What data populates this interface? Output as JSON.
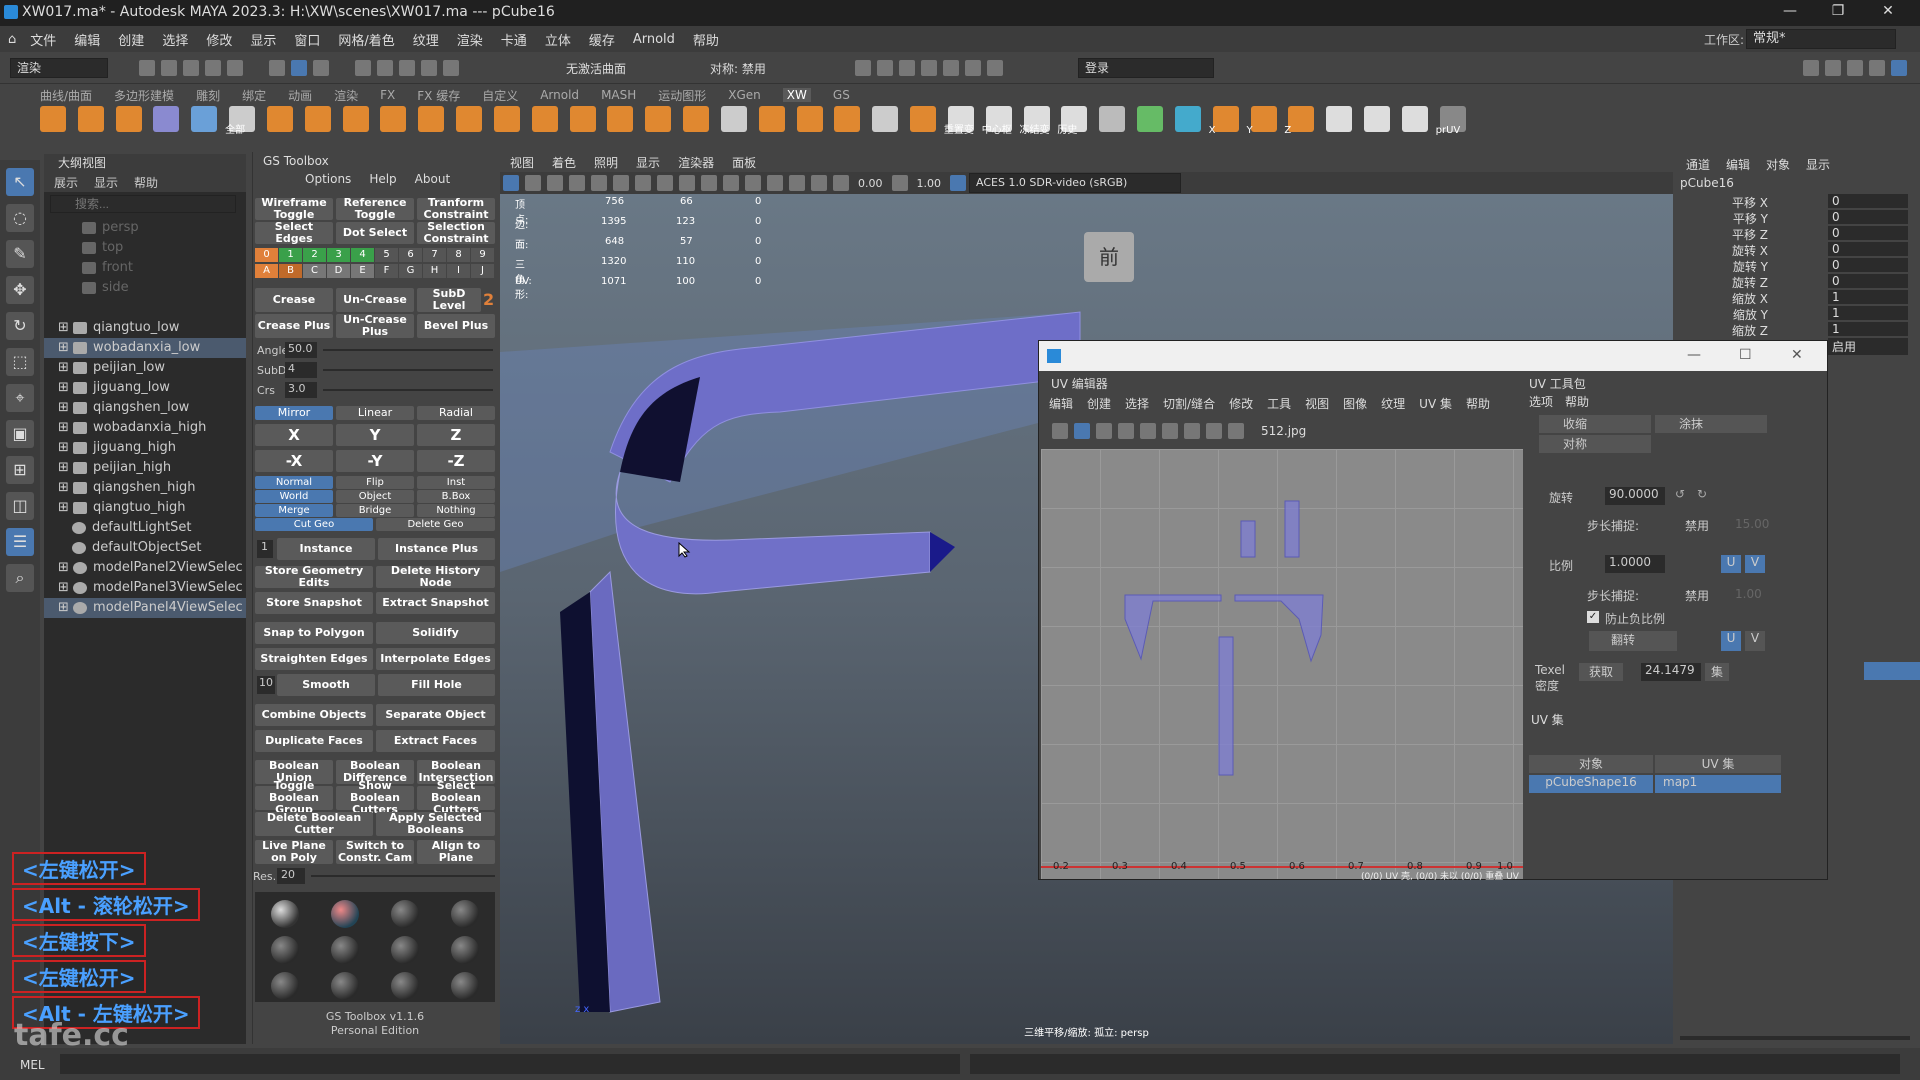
{
  "titlebar": {
    "title": "XW017.ma* - Autodesk MAYA 2023.3: H:\\XW\\scenes\\XW017.ma  ---  pCube16",
    "workspace_label": "工作区:",
    "workspace_value": "常规*"
  },
  "menubar": {
    "items": [
      "文件",
      "编辑",
      "创建",
      "选择",
      "修改",
      "显示",
      "窗口",
      "网格/着色",
      "纹理",
      "渲染",
      "卡通",
      "立体",
      "缓存",
      "Arnold",
      "帮助"
    ]
  },
  "status": {
    "mode": "渲染",
    "live_surface": "无激活曲面",
    "symmetry": "对称: 禁用",
    "login": "登录"
  },
  "shelf": {
    "tabs": [
      "曲线/曲面",
      "多边形建模",
      "雕刻",
      "绑定",
      "动画",
      "渲染",
      "FX",
      "FX 缓存",
      "自定义",
      "Arnold",
      "MASH",
      "运动图形",
      "XGen",
      "XW",
      "GS"
    ],
    "active_tab": "XW",
    "labels": {
      "all": "全部",
      "reset": "重置变",
      "center": "中心枢",
      "freeze": "冻结变",
      "history": "历史",
      "x": "X",
      "y": "Y",
      "z": "Z",
      "pruv": "prUV"
    }
  },
  "outliner": {
    "title": "大纲视图",
    "menu": [
      "展示",
      "显示",
      "帮助"
    ],
    "search_placeholder": "搜索...",
    "items": [
      {
        "label": "persp",
        "dim": true
      },
      {
        "label": "top",
        "dim": true
      },
      {
        "label": "front",
        "dim": true
      },
      {
        "label": "side",
        "dim": true
      },
      {
        "label": "qiangtuo_low"
      },
      {
        "label": "wobadanxia_low",
        "selected": true
      },
      {
        "label": "peijian_low"
      },
      {
        "label": "jiguang_low"
      },
      {
        "label": "qiangshen_low"
      },
      {
        "label": "wobadanxia_high"
      },
      {
        "label": "jiguang_high"
      },
      {
        "label": "peijian_high"
      },
      {
        "label": "qiangshen_high"
      },
      {
        "label": "qiangtuo_high"
      },
      {
        "label": "defaultLightSet"
      },
      {
        "label": "defaultObjectSet"
      },
      {
        "label": "modelPanel2ViewSelec"
      },
      {
        "label": "modelPanel3ViewSelec"
      },
      {
        "label": "modelPanel4ViewSelec",
        "selected": true
      }
    ]
  },
  "gs": {
    "title": "GS Toolbox",
    "menu": [
      "Options",
      "Help",
      "About"
    ],
    "wireframe": "Wireframe Toggle",
    "reference": "Reference Toggle",
    "transform": "Tranform Constraint",
    "select_edges": "Select Edges",
    "dot_select": "Dot Select",
    "selection_constraint": "Selection Constraint",
    "nums": [
      "0",
      "1",
      "2",
      "3",
      "4",
      "5",
      "6",
      "7",
      "8",
      "9"
    ],
    "letters": [
      "A",
      "B",
      "C",
      "D",
      "E",
      "F",
      "G",
      "H",
      "I",
      "J"
    ],
    "crease": "Crease",
    "uncrease": "Un-Crease",
    "subd_level": "SubD Level",
    "subd_value": "2",
    "crease_plus": "Crease Plus",
    "uncrease_plus": "Un-Crease Plus",
    "bevel_plus": "Bevel Plus",
    "angle_label": "Angle",
    "angle": "50.0",
    "subd_label": "SubD",
    "subd": "4",
    "crs_label": "Crs",
    "crs": "3.0",
    "mirror": "Mirror",
    "linear": "Linear",
    "radial": "Radial",
    "x": "X",
    "y": "Y",
    "z": "Z",
    "nx": "-X",
    "ny": "-Y",
    "nz": "-Z",
    "normal": "Normal",
    "flip": "Flip",
    "inst": "Inst",
    "world": "World",
    "object": "Object",
    "bbox": "B.Box",
    "merge": "Merge",
    "bridge": "Bridge",
    "nothing": "Nothing",
    "cutgeo": "Cut Geo",
    "deletegeo": "Delete Geo",
    "inst_count": "1",
    "instance": "Instance",
    "instance_plus": "Instance Plus",
    "store_geo": "Store Geometry Edits",
    "delete_history": "Delete History Node",
    "store_snap": "Store Snapshot",
    "extract_snap": "Extract Snapshot",
    "snap_poly": "Snap to Polygon",
    "solidify": "Solidify",
    "straighten": "Straighten Edges",
    "interpolate": "Interpolate Edges",
    "smooth_count": "10",
    "smooth": "Smooth",
    "fillhole": "Fill Hole",
    "combine": "Combine Objects",
    "separate": "Separate Object",
    "duplicate": "Duplicate Faces",
    "extract": "Extract Faces",
    "bool_union": "Boolean Union",
    "bool_diff": "Boolean Difference",
    "bool_inter": "Boolean Intersection",
    "toggle_bool": "Toggle Boolean Group",
    "show_cutters": "Show Boolean Cutters",
    "select_cutters": "Select Boolean Cutters",
    "delete_cutter": "Delete Boolean Cutter",
    "apply_bool": "Apply Selected Booleans",
    "live_plane": "Live Plane on Poly",
    "switch_cam": "Switch to Constr. Cam",
    "align_plane": "Align to Plane",
    "res_label": "Res.",
    "res": "20",
    "version": "GS Toolbox v1.1.6",
    "edition": "Personal Edition"
  },
  "viewport": {
    "menu": [
      "视图",
      "着色",
      "照明",
      "显示",
      "渲染器",
      "面板"
    ],
    "val_a": "0.00",
    "val_b": "1.00",
    "colorspace": "ACES 1.0 SDR-video (sRGB)",
    "hud": [
      [
        "顶点:",
        "756",
        "66",
        "0"
      ],
      [
        "边:",
        "1395",
        "123",
        "0"
      ],
      [
        "面:",
        "648",
        "57",
        "0"
      ],
      [
        "三角形:",
        "1320",
        "110",
        "0"
      ],
      [
        "UV:",
        "1071",
        "100",
        "0"
      ]
    ],
    "cube_label": "前",
    "footer": "三维平移/缩放: 孤立: persp"
  },
  "uv": {
    "title": "UV 编辑器",
    "menu": [
      "编辑",
      "创建",
      "选择",
      "切割/缝合",
      "修改",
      "工具",
      "视图",
      "图像",
      "纹理",
      "UV 集",
      "帮助"
    ],
    "texture": "512.jpg",
    "ticks": [
      "0.2",
      "0.3",
      "0.4",
      "0.5",
      "0.6",
      "0.7",
      "0.8",
      "0.9",
      "1.0"
    ],
    "status": "(0/0) UV 壳, (0/0) 未以 (0/0) 重叠 UV",
    "toolkit": {
      "title": "UV 工具包",
      "menu": [
        "选项",
        "帮助"
      ],
      "shrink": "收缩",
      "smear": "涂抹",
      "symmetry": "对称",
      "rotate_label": "旋转",
      "rotate": "90.0000",
      "step_label": "步长捕捉:",
      "step": "禁用",
      "step_val": "15.00",
      "scale_label": "比例",
      "scale": "1.0000",
      "step2": "禁用",
      "step2_val": "1.00",
      "prevent_neg": "防止负比例",
      "flip": "翻转",
      "u": "U",
      "v": "V",
      "texel_label": "Texel 密度",
      "get": "获取",
      "texel": "24.1479",
      "set": "集",
      "uvset_title": "UV 集",
      "obj_header": "对象",
      "set_header": "UV 集",
      "obj": "pCubeShape16",
      "setname": "map1"
    }
  },
  "channel": {
    "menu": [
      "通道",
      "编辑",
      "对象",
      "显示"
    ],
    "object": "pCube16",
    "attrs": [
      [
        "平移 X",
        "0"
      ],
      [
        "平移 Y",
        "0"
      ],
      [
        "平移 Z",
        "0"
      ],
      [
        "旋转 X",
        "0"
      ],
      [
        "旋转 Y",
        "0"
      ],
      [
        "旋转 Z",
        "0"
      ],
      [
        "缩放 X",
        "1"
      ],
      [
        "缩放 Y",
        "1"
      ],
      [
        "缩放 Z",
        "1"
      ]
    ],
    "visibility": "启用"
  },
  "hotkeys": [
    "<左键松开>",
    "<Alt - 滚轮松开>",
    "<左键按下>",
    "<左键松开>",
    "<Alt - 左键松开>"
  ],
  "bottom": {
    "mel": "MEL",
    "watermark": "tafe.cc"
  }
}
